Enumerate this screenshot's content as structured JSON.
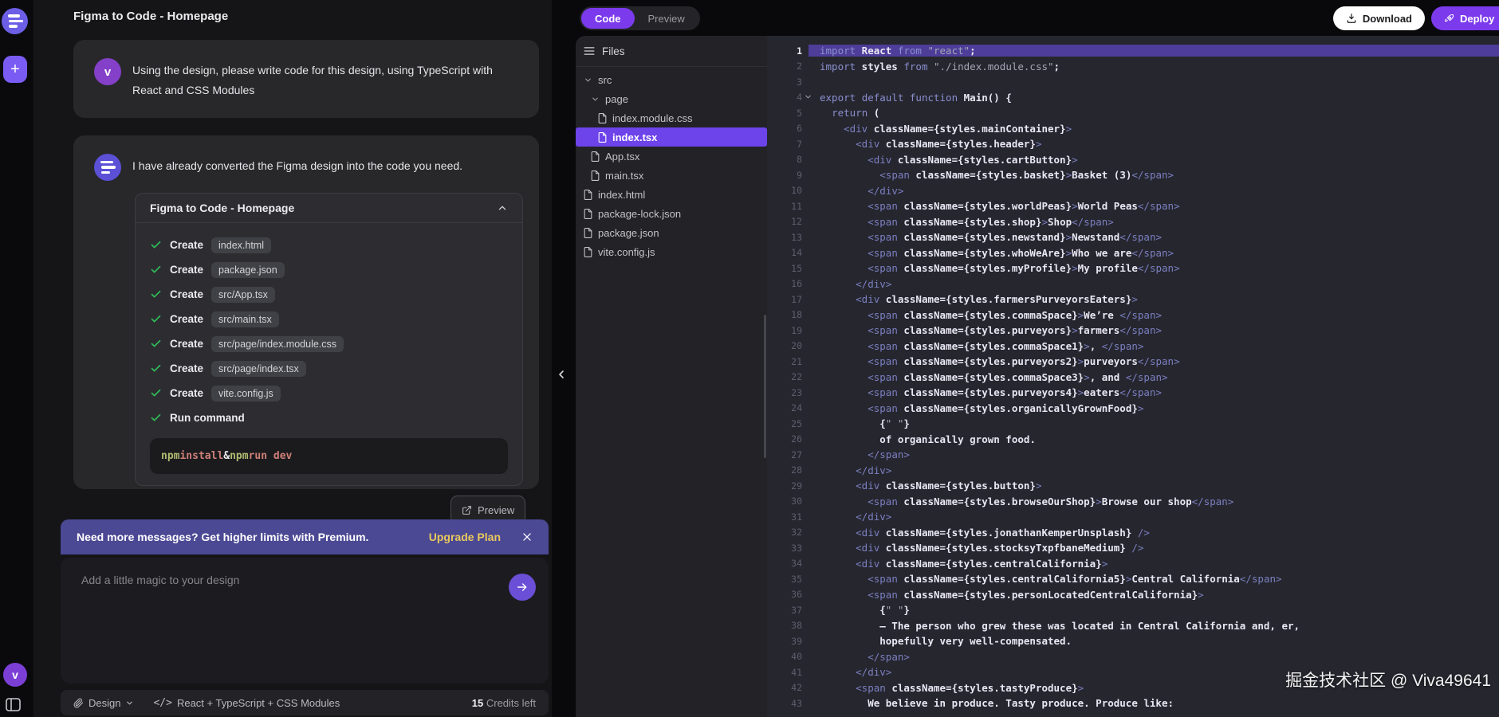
{
  "app": {
    "watermark": "掘金技术社区 @ Viva49641"
  },
  "rail": {
    "new_button": "+",
    "avatar_letter": "v"
  },
  "chat": {
    "title": "Figma to Code - Homepage",
    "user_message": {
      "avatar_letter": "v",
      "text": "Using the design, please write code for this design, using TypeScript with React and CSS Modules"
    },
    "assistant_message": {
      "intro": "I have already converted the Figma design into the code you need.",
      "card": {
        "title": "Figma to Code - Homepage",
        "tasks": [
          {
            "action": "Create",
            "target": "index.html"
          },
          {
            "action": "Create",
            "target": "package.json"
          },
          {
            "action": "Create",
            "target": "src/App.tsx"
          },
          {
            "action": "Create",
            "target": "src/main.tsx"
          },
          {
            "action": "Create",
            "target": "src/page/index.module.css"
          },
          {
            "action": "Create",
            "target": "src/page/index.tsx"
          },
          {
            "action": "Create",
            "target": "vite.config.js"
          },
          {
            "action": "Run command",
            "target": ""
          }
        ],
        "command_tokens": [
          {
            "text": "npm ",
            "c": "cmd"
          },
          {
            "text": "install",
            "c": "arg"
          },
          {
            "text": " & ",
            "c": "op"
          },
          {
            "text": "npm ",
            "c": "cmd"
          },
          {
            "text": "run dev",
            "c": "arg"
          }
        ]
      },
      "preview_button": "Preview"
    },
    "banner": {
      "text": "Need more messages? Get higher limits with Premium.",
      "cta": "Upgrade Plan"
    },
    "composer": {
      "placeholder": "Add a little magic to your design"
    },
    "footer": {
      "design": "Design",
      "stack_icon": "</>",
      "stack": "React + TypeScript + CSS Modules",
      "credits_value": "15",
      "credits_label": "Credits left"
    }
  },
  "workspace": {
    "tabs": {
      "code": "Code",
      "preview": "Preview"
    },
    "download": "Download",
    "deploy": "Deploy",
    "files": {
      "header": "Files",
      "tree": [
        {
          "label": "src",
          "type": "folder",
          "indent": 0,
          "selected": false
        },
        {
          "label": "page",
          "type": "folder",
          "indent": 1,
          "selected": false
        },
        {
          "label": "index.module.css",
          "type": "file",
          "indent": 2,
          "selected": false
        },
        {
          "label": "index.tsx",
          "type": "file",
          "indent": 2,
          "selected": true
        },
        {
          "label": "App.tsx",
          "type": "file",
          "indent": 1,
          "selected": false
        },
        {
          "label": "main.tsx",
          "type": "file",
          "indent": 1,
          "selected": false
        },
        {
          "label": "index.html",
          "type": "file",
          "indent": 0,
          "selected": false
        },
        {
          "label": "package-lock.json",
          "type": "file",
          "indent": 0,
          "selected": false
        },
        {
          "label": "package.json",
          "type": "file",
          "indent": 0,
          "selected": false
        },
        {
          "label": "vite.config.js",
          "type": "file",
          "indent": 0,
          "selected": false
        }
      ]
    },
    "editor": {
      "active_line": 1,
      "fold_lines": [
        4
      ],
      "lines": [
        "import React from \"react\";",
        "import styles from \"./index.module.css\";",
        "",
        "export default function Main() {",
        "  return (",
        "    <div className={styles.mainContainer}>",
        "      <div className={styles.header}>",
        "        <div className={styles.cartButton}>",
        "          <span className={styles.basket}>Basket (3)</span>",
        "        </div>",
        "        <span className={styles.worldPeas}>World Peas</span>",
        "        <span className={styles.shop}>Shop</span>",
        "        <span className={styles.newstand}>Newstand</span>",
        "        <span className={styles.whoWeAre}>Who we are</span>",
        "        <span className={styles.myProfile}>My profile</span>",
        "      </div>",
        "      <div className={styles.farmersPurveyorsEaters}>",
        "        <span className={styles.commaSpace}>We’re </span>",
        "        <span className={styles.purveyors}>farmers</span>",
        "        <span className={styles.commaSpace1}>, </span>",
        "        <span className={styles.purveyors2}>purveyors</span>",
        "        <span className={styles.commaSpace3}>, and </span>",
        "        <span className={styles.purveyors4}>eaters</span>",
        "        <span className={styles.organicallyGrownFood}>",
        "          {\" \"}",
        "          of organically grown food.",
        "        </span>",
        "      </div>",
        "      <div className={styles.button}>",
        "        <span className={styles.browseOurShop}>Browse our shop</span>",
        "      </div>",
        "      <div className={styles.jonathanKemperUnsplash} />",
        "      <div className={styles.stocksyTxpfbaneMedium} />",
        "      <div className={styles.centralCalifornia}>",
        "        <span className={styles.centralCalifornia5}>Central California</span>",
        "        <span className={styles.personLocatedCentralCalifornia}>",
        "          {\" \"}",
        "          — The person who grew these was located in Central California and, er,",
        "          hopefully very well-compensated.",
        "        </span>",
        "      </div>",
        "      <span className={styles.tastyProduce}>",
        "        We believe in produce. Tasty produce. Produce like:"
      ]
    }
  },
  "colors": {
    "accent": "#7c3aed",
    "banner": "#4b4894",
    "upgrade_cta": "#e9c95c",
    "success_check": "#2ebd59",
    "file_selected": "#6d43ea",
    "line_selection": "#4e3d99"
  }
}
